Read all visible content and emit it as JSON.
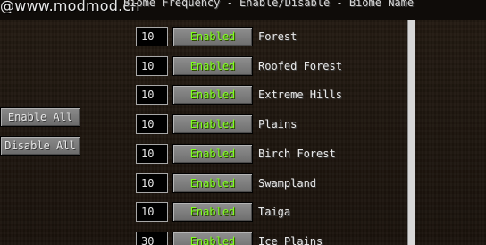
{
  "watermark": "@www.modmod.cn",
  "heading": "Biome Frequency - Enable/Disable - Biome Name",
  "side_buttons": {
    "enable_all": "Enable All",
    "disable_all": "Disable All"
  },
  "colors": {
    "enabled_text": "#80ff20",
    "text": "#e8e8e8"
  },
  "biomes": [
    {
      "frequency": "10",
      "status": "Enabled",
      "name": "Forest"
    },
    {
      "frequency": "10",
      "status": "Enabled",
      "name": "Roofed Forest"
    },
    {
      "frequency": "10",
      "status": "Enabled",
      "name": "Extreme Hills"
    },
    {
      "frequency": "10",
      "status": "Enabled",
      "name": "Plains"
    },
    {
      "frequency": "10",
      "status": "Enabled",
      "name": "Birch Forest"
    },
    {
      "frequency": "10",
      "status": "Enabled",
      "name": "Swampland"
    },
    {
      "frequency": "10",
      "status": "Enabled",
      "name": "Taiga"
    },
    {
      "frequency": "30",
      "status": "Enabled",
      "name": "Ice Plains"
    }
  ]
}
